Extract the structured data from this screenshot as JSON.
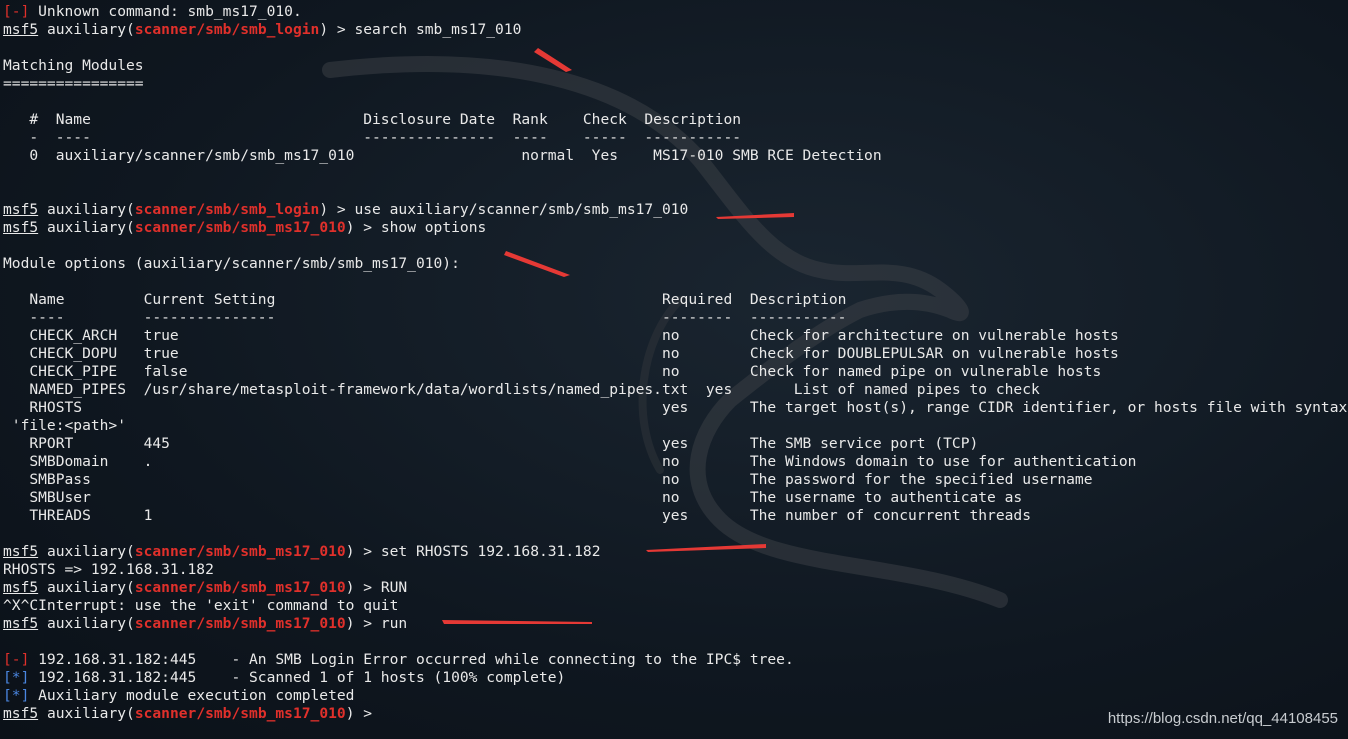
{
  "lines": [
    {
      "parts": [
        {
          "t": "[-]",
          "c": "err"
        },
        {
          "t": " Unknown command: smb_ms17_010."
        }
      ]
    },
    {
      "parts": [
        {
          "t": "msf5",
          "c": "u"
        },
        {
          "t": " auxiliary("
        },
        {
          "t": "scanner/smb/smb_login",
          "c": "red"
        },
        {
          "t": ") > search smb_ms17_010"
        }
      ]
    },
    {
      "parts": [
        {
          "t": ""
        }
      ]
    },
    {
      "parts": [
        {
          "t": "Matching Modules"
        }
      ]
    },
    {
      "parts": [
        {
          "t": "================"
        }
      ]
    },
    {
      "parts": [
        {
          "t": ""
        }
      ]
    },
    {
      "parts": [
        {
          "t": "   #  Name                               Disclosure Date  Rank    Check  Description"
        }
      ]
    },
    {
      "parts": [
        {
          "t": "   -  ----                               ---------------  ----    -----  -----------"
        }
      ]
    },
    {
      "parts": [
        {
          "t": "   0  auxiliary/scanner/smb/smb_ms17_010                   normal  Yes    MS17-010 SMB RCE Detection"
        }
      ]
    },
    {
      "parts": [
        {
          "t": ""
        }
      ]
    },
    {
      "parts": [
        {
          "t": ""
        }
      ]
    },
    {
      "parts": [
        {
          "t": "msf5",
          "c": "u"
        },
        {
          "t": " auxiliary("
        },
        {
          "t": "scanner/smb/smb_login",
          "c": "red"
        },
        {
          "t": ") > use auxiliary/scanner/smb/smb_ms17_010"
        }
      ]
    },
    {
      "parts": [
        {
          "t": "msf5",
          "c": "u"
        },
        {
          "t": " auxiliary("
        },
        {
          "t": "scanner/smb/smb_ms17_010",
          "c": "red"
        },
        {
          "t": ") > show options"
        }
      ]
    },
    {
      "parts": [
        {
          "t": ""
        }
      ]
    },
    {
      "parts": [
        {
          "t": "Module options (auxiliary/scanner/smb/smb_ms17_010):"
        }
      ]
    },
    {
      "parts": [
        {
          "t": ""
        }
      ]
    },
    {
      "parts": [
        {
          "t": "   Name         Current Setting                                            Required  Description"
        }
      ]
    },
    {
      "parts": [
        {
          "t": "   ----         ---------------                                            --------  -----------"
        }
      ]
    },
    {
      "parts": [
        {
          "t": "   CHECK_ARCH   true                                                       no        Check for architecture on vulnerable hosts"
        }
      ]
    },
    {
      "parts": [
        {
          "t": "   CHECK_DOPU   true                                                       no        Check for DOUBLEPULSAR on vulnerable hosts"
        }
      ]
    },
    {
      "parts": [
        {
          "t": "   CHECK_PIPE   false                                                      no        Check for named pipe on vulnerable hosts"
        }
      ]
    },
    {
      "parts": [
        {
          "t": "   NAMED_PIPES  /usr/share/metasploit-framework/data/wordlists/named_pipes.txt  yes       List of named pipes to check"
        }
      ]
    },
    {
      "parts": [
        {
          "t": "   RHOSTS                                                                  yes       The target host(s), range CIDR identifier, or hosts file with syntax"
        }
      ]
    },
    {
      "parts": [
        {
          "t": " 'file:<path>'"
        }
      ]
    },
    {
      "parts": [
        {
          "t": "   RPORT        445                                                        yes       The SMB service port (TCP)"
        }
      ]
    },
    {
      "parts": [
        {
          "t": "   SMBDomain    .                                                          no        The Windows domain to use for authentication"
        }
      ]
    },
    {
      "parts": [
        {
          "t": "   SMBPass                                                                 no        The password for the specified username"
        }
      ]
    },
    {
      "parts": [
        {
          "t": "   SMBUser                                                                 no        The username to authenticate as"
        }
      ]
    },
    {
      "parts": [
        {
          "t": "   THREADS      1                                                          yes       The number of concurrent threads"
        }
      ]
    },
    {
      "parts": [
        {
          "t": ""
        }
      ]
    },
    {
      "parts": [
        {
          "t": "msf5",
          "c": "u"
        },
        {
          "t": " auxiliary("
        },
        {
          "t": "scanner/smb/smb_ms17_010",
          "c": "red"
        },
        {
          "t": ") > set RHOSTS 192.168.31.182"
        }
      ]
    },
    {
      "parts": [
        {
          "t": "RHOSTS => 192.168.31.182"
        }
      ]
    },
    {
      "parts": [
        {
          "t": "msf5",
          "c": "u"
        },
        {
          "t": " auxiliary("
        },
        {
          "t": "scanner/smb/smb_ms17_010",
          "c": "red"
        },
        {
          "t": ") > RUN"
        }
      ]
    },
    {
      "parts": [
        {
          "t": "^X^CInterrupt: use the 'exit' command to quit"
        }
      ]
    },
    {
      "parts": [
        {
          "t": "msf5",
          "c": "u"
        },
        {
          "t": " auxiliary("
        },
        {
          "t": "scanner/smb/smb_ms17_010",
          "c": "red"
        },
        {
          "t": ") > run"
        }
      ]
    },
    {
      "parts": [
        {
          "t": ""
        }
      ]
    },
    {
      "parts": [
        {
          "t": "[-]",
          "c": "err"
        },
        {
          "t": " 192.168.31.182:445    - An SMB Login Error occurred while connecting to the IPC$ tree."
        }
      ]
    },
    {
      "parts": [
        {
          "t": "[*]",
          "c": "blue"
        },
        {
          "t": " 192.168.31.182:445    - Scanned 1 of 1 hosts (100% complete)"
        }
      ]
    },
    {
      "parts": [
        {
          "t": "[*]",
          "c": "blue"
        },
        {
          "t": " Auxiliary module execution completed"
        }
      ]
    },
    {
      "parts": [
        {
          "t": "msf5",
          "c": "u"
        },
        {
          "t": " auxiliary("
        },
        {
          "t": "scanner/smb/smb_ms17_010",
          "c": "red"
        },
        {
          "t": ") > "
        }
      ]
    }
  ],
  "watermark": "https://blog.csdn.net/qq_44108455",
  "colors": {
    "background": "#0f1720",
    "text": "#e9e9e9",
    "accent_red": "#e0302b",
    "info_blue": "#4a86e0",
    "arrow_red": "#e53935"
  }
}
